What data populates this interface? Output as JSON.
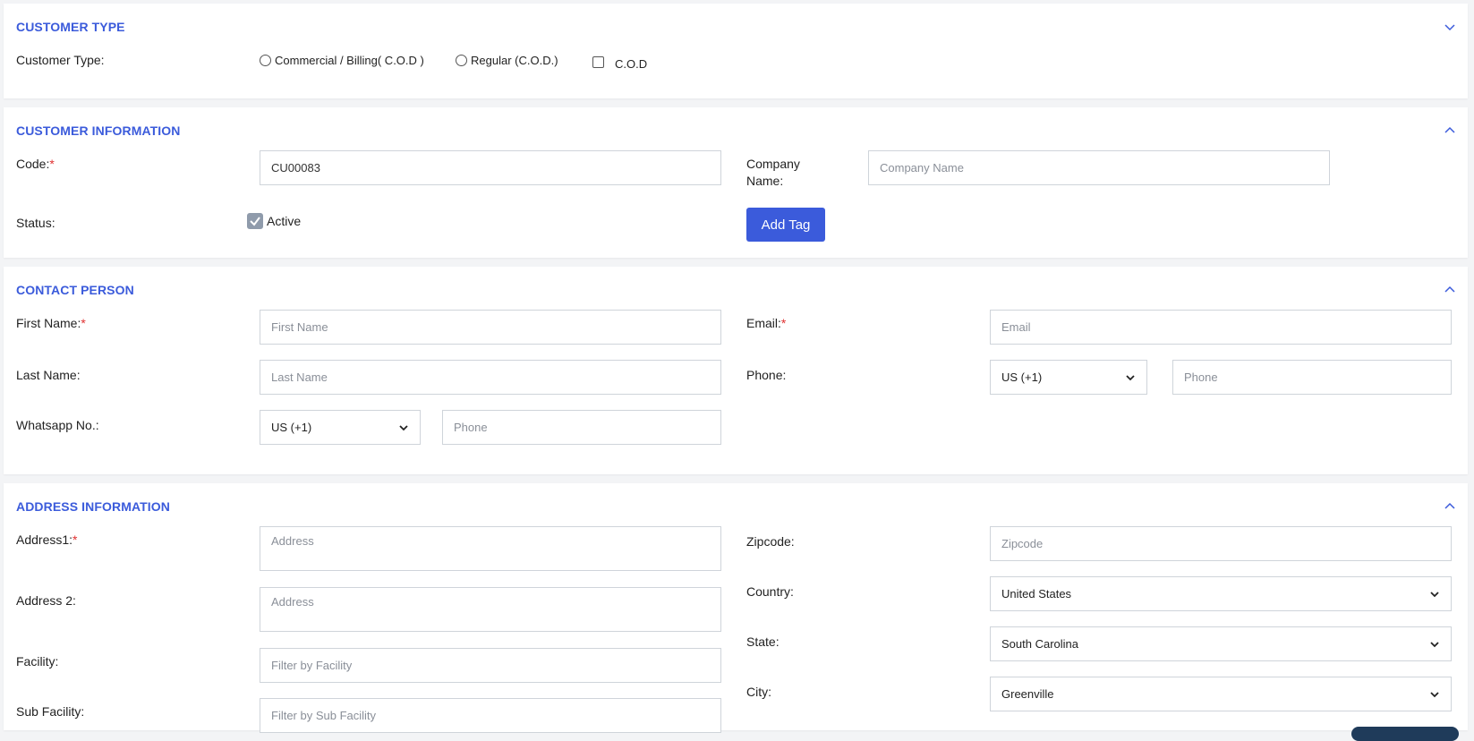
{
  "customer_type": {
    "title": "CUSTOMER TYPE",
    "label": "Customer Type:",
    "options": [
      "Commercial / Billing( C.O.D )",
      "Regular (C.O.D.)"
    ],
    "checkbox": "C.O.D"
  },
  "customer_info": {
    "title": "CUSTOMER INFORMATION",
    "code_label": "Code:",
    "code_value": "CU00083",
    "company_label_1": "Company",
    "company_label_2": "Name:",
    "company_placeholder": "Company Name",
    "status_label": "Status:",
    "active_label": "Active",
    "add_tag": "Add Tag"
  },
  "contact": {
    "title": "CONTACT PERSON",
    "first_label": "First Name:",
    "first_placeholder": "First Name",
    "last_label": "Last Name:",
    "last_placeholder": "Last Name",
    "whatsapp_label": "Whatsapp No.:",
    "whatsapp_code": "US (+1)",
    "whatsapp_placeholder": "Phone",
    "email_label": "Email:",
    "email_placeholder": "Email",
    "phone_label": "Phone:",
    "phone_code": "US (+1)",
    "phone_placeholder": "Phone"
  },
  "address": {
    "title": "ADDRESS INFORMATION",
    "address1_label": "Address1:",
    "address1_placeholder": "Address",
    "address2_label": "Address 2:",
    "address2_placeholder": "Address",
    "facility_label": "Facility:",
    "facility_placeholder": "Filter by Facility",
    "subfacility_label": "Sub Facility:",
    "subfacility_placeholder": "Filter by Sub Facility",
    "zipcode_label": "Zipcode:",
    "zipcode_placeholder": "Zipcode",
    "country_label": "Country:",
    "country_value": "United States",
    "state_label": "State:",
    "state_value": "South Carolina",
    "city_label": "City:",
    "city_value": "Greenville"
  },
  "required_mark": "*",
  "colors": {
    "accent": "#3b5bdb",
    "required": "#e03131"
  }
}
